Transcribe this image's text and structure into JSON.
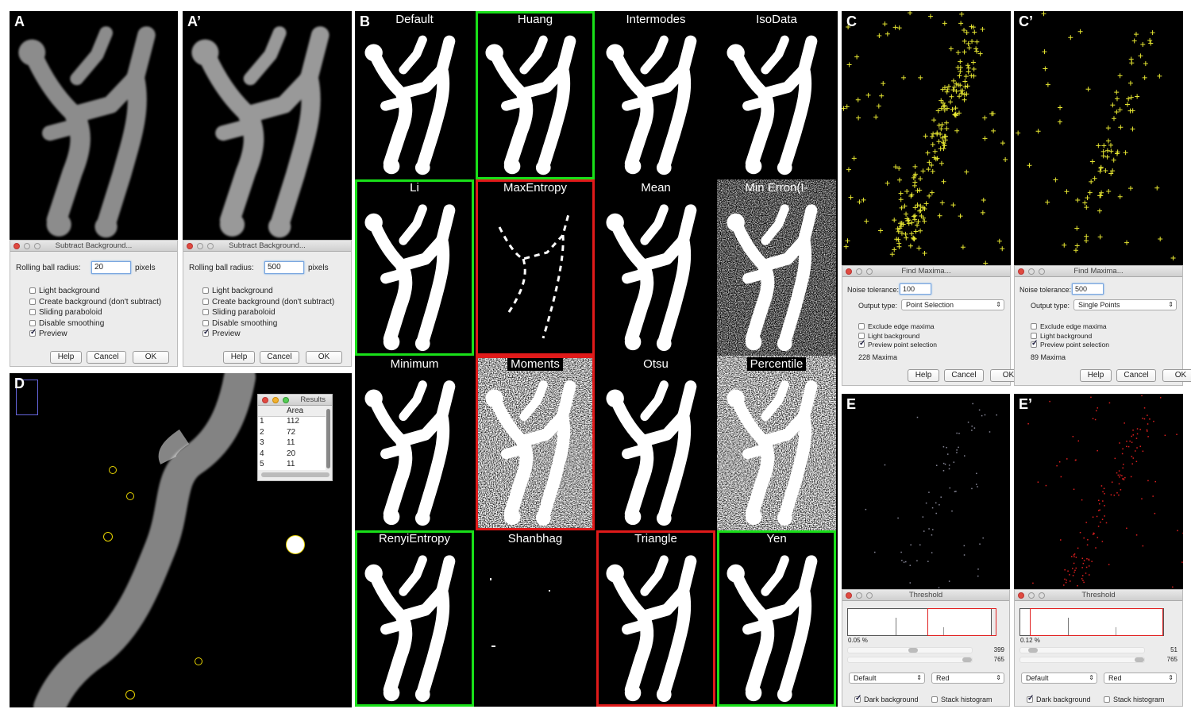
{
  "panels": {
    "A": "A",
    "A2": "A’",
    "B": "B",
    "C": "C",
    "C2": "C’",
    "D": "D",
    "E": "E",
    "E2": "E’"
  },
  "subtract_bg": [
    {
      "title": "Subtract Background...",
      "radius_label": "Rolling ball radius:",
      "radius": "20",
      "unit": "pixels",
      "options": [
        {
          "label": "Light background",
          "checked": false
        },
        {
          "label": "Create background (don't subtract)",
          "checked": false
        },
        {
          "label": "Sliding paraboloid",
          "checked": false
        },
        {
          "label": "Disable smoothing",
          "checked": false
        },
        {
          "label": "Preview",
          "checked": true
        }
      ],
      "help": "Help",
      "cancel": "Cancel",
      "ok": "OK"
    },
    {
      "title": "Subtract Background...",
      "radius_label": "Rolling ball radius:",
      "radius": "500",
      "unit": "pixels",
      "options": [
        {
          "label": "Light background",
          "checked": false
        },
        {
          "label": "Create background (don't subtract)",
          "checked": false
        },
        {
          "label": "Sliding paraboloid",
          "checked": false
        },
        {
          "label": "Disable smoothing",
          "checked": false
        },
        {
          "label": "Preview",
          "checked": true
        }
      ],
      "help": "Help",
      "cancel": "Cancel",
      "ok": "OK"
    }
  ],
  "methods": [
    {
      "name": "Default",
      "frame": "none",
      "style": "clean"
    },
    {
      "name": "Huang",
      "frame": "green",
      "style": "clean"
    },
    {
      "name": "Intermodes",
      "frame": "none",
      "style": "clean"
    },
    {
      "name": "IsoData",
      "frame": "none",
      "style": "clean"
    },
    {
      "name": "Li",
      "frame": "green",
      "style": "thick"
    },
    {
      "name": "MaxEntropy",
      "frame": "red",
      "style": "sparse"
    },
    {
      "name": "Mean",
      "frame": "none",
      "style": "thick"
    },
    {
      "name": "Min Erron(I-",
      "frame": "none",
      "style": "noisy"
    },
    {
      "name": "Minimum",
      "frame": "none",
      "style": "clean"
    },
    {
      "name": "Moments",
      "frame": "red",
      "style": "verynoisy"
    },
    {
      "name": "Otsu",
      "frame": "none",
      "style": "clean"
    },
    {
      "name": "Percentile",
      "frame": "none",
      "style": "verynoisy"
    },
    {
      "name": "RenyiEntropy",
      "frame": "green",
      "style": "clean"
    },
    {
      "name": "Shanbhag",
      "frame": "none",
      "style": "empty"
    },
    {
      "name": "Triangle",
      "frame": "red",
      "style": "thick"
    },
    {
      "name": "Yen",
      "frame": "green",
      "style": "clean"
    }
  ],
  "colors": {
    "green": "#19e019",
    "red": "#e01a1a",
    "maxima": "#e6e632",
    "roi": "#e6d200",
    "threshold": "#e02020"
  },
  "find_maxima": [
    {
      "title": "Find Maxima...",
      "noise_label": "Noise tolerance:",
      "noise": "100",
      "output_label": "Output type:",
      "output": "Point Selection",
      "options": [
        {
          "label": "Exclude edge maxima",
          "checked": false
        },
        {
          "label": "Light background",
          "checked": false
        },
        {
          "label": "Preview point selection",
          "checked": true
        }
      ],
      "count": "228 Maxima",
      "help": "Help",
      "cancel": "Cancel",
      "ok": "OK"
    },
    {
      "title": "Find Maxima...",
      "noise_label": "Noise tolerance:",
      "noise": "500",
      "output_label": "Output type:",
      "output": "Single Points",
      "options": [
        {
          "label": "Exclude edge maxima",
          "checked": false
        },
        {
          "label": "Light background",
          "checked": false
        },
        {
          "label": "Preview point selection",
          "checked": true
        }
      ],
      "count": "89 Maxima",
      "help": "Help",
      "cancel": "Cancel",
      "ok": "OK"
    }
  ],
  "results": {
    "title": "Results",
    "column": "Area",
    "rows": [
      [
        "1",
        "112"
      ],
      [
        "2",
        "72"
      ],
      [
        "3",
        "11"
      ],
      [
        "4",
        "20"
      ],
      [
        "5",
        "11"
      ]
    ]
  },
  "threshold": [
    {
      "title": "Threshold",
      "percent": "0.05 %",
      "min": "399",
      "max": "765",
      "min_frac": 0.52,
      "max_frac": 1.0,
      "method": "Default",
      "mode": "Red",
      "dark_bg_label": "Dark background",
      "dark_bg": true,
      "stack_label": "Stack histogram",
      "stack": false
    },
    {
      "title": "Threshold",
      "percent": "0.12 %",
      "min": "51",
      "max": "765",
      "min_frac": 0.07,
      "max_frac": 1.0,
      "method": "Default",
      "mode": "Red",
      "dark_bg_label": "Dark background",
      "dark_bg": true,
      "stack_label": "Stack histogram",
      "stack": false
    }
  ]
}
